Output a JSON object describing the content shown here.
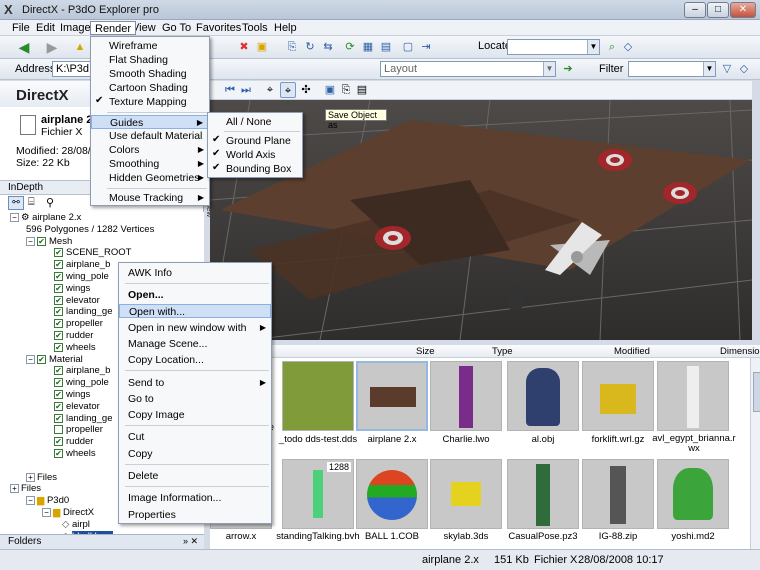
{
  "window": {
    "title": "DirectX - P3dO Explorer pro"
  },
  "menubar": [
    "File",
    "Edit",
    "Image",
    "Render",
    "View",
    "Go To",
    "Favorites",
    "Tools",
    "Help"
  ],
  "toolbar": {
    "locate_label": "Locate",
    "layout_placeholder": "Layout",
    "filter_label": "Filter",
    "address_label": "Address",
    "address_value": "K:\\P3d"
  },
  "left": {
    "header": "DirectX",
    "file_name": "airplane 2.",
    "file_type": "Fichier X",
    "modified": "Modified: 28/08/2",
    "size": "Size: 22 Kb",
    "indepth": "InDepth",
    "folders": "Folders"
  },
  "tree": [
    {
      "label": "airplane 2.x",
      "indent": 10,
      "kind": "root"
    },
    {
      "label": "596 Polygones / 1282 Vertices",
      "indent": 26,
      "kind": "text"
    },
    {
      "label": "Mesh",
      "indent": 26,
      "kind": "check-exp"
    },
    {
      "label": "SCENE_ROOT",
      "indent": 54,
      "kind": "check"
    },
    {
      "label": "airplane_b",
      "indent": 54,
      "kind": "check"
    },
    {
      "label": "wing_pole",
      "indent": 54,
      "kind": "check"
    },
    {
      "label": "wings",
      "indent": 54,
      "kind": "check"
    },
    {
      "label": "elevator",
      "indent": 54,
      "kind": "check"
    },
    {
      "label": "landing_ge",
      "indent": 54,
      "kind": "check"
    },
    {
      "label": "propeller",
      "indent": 54,
      "kind": "check"
    },
    {
      "label": "rudder",
      "indent": 54,
      "kind": "check"
    },
    {
      "label": "wheels",
      "indent": 54,
      "kind": "check"
    },
    {
      "label": "Material",
      "indent": 26,
      "kind": "check-exp"
    },
    {
      "label": "airplane_b",
      "indent": 54,
      "kind": "check"
    },
    {
      "label": "wing_pole",
      "indent": 54,
      "kind": "check"
    },
    {
      "label": "wings",
      "indent": 54,
      "kind": "check"
    },
    {
      "label": "elevator",
      "indent": 54,
      "kind": "check"
    },
    {
      "label": "landing_ge",
      "indent": 54,
      "kind": "check"
    },
    {
      "label": "propeller",
      "indent": 54,
      "kind": "uncheck"
    },
    {
      "label": "rudder",
      "indent": 54,
      "kind": "check"
    },
    {
      "label": "wheels",
      "indent": 54,
      "kind": "check"
    },
    {
      "label": "",
      "indent": 26,
      "kind": "text"
    },
    {
      "label": "Files",
      "indent": 26,
      "kind": "exp"
    },
    {
      "label": "Files",
      "indent": 10,
      "kind": "exp"
    },
    {
      "label": "P3d0",
      "indent": 26,
      "kind": "folder"
    },
    {
      "label": "DirectX",
      "indent": 42,
      "kind": "folder"
    },
    {
      "label": "airpl",
      "indent": 62,
      "kind": "file"
    },
    {
      "label": "bhull.bmp",
      "indent": 62,
      "kind": "file-sel"
    }
  ],
  "render_menu": [
    "Wireframe",
    "Flat Shading",
    "Smooth Shading",
    "Cartoon Shading",
    "Texture Mapping",
    "Guides",
    "Use default Material",
    "Colors",
    "Smoothing",
    "Hidden Geometries",
    "Mouse Tracking"
  ],
  "guides_menu": [
    "All / None",
    "Ground Plane",
    "World Axis",
    "Bounding Box"
  ],
  "tooltip": "Save Object as",
  "viewport_tab": "View",
  "context_menu": [
    "AWK Info",
    "Open...",
    "Open with...",
    "Open in new window with",
    "Manage Scene...",
    "Copy Location...",
    "Send to",
    "Go to",
    "Copy Image",
    "Cut",
    "Copy",
    "Delete",
    "Image Information...",
    "Properties"
  ],
  "columns": [
    "Size",
    "Type",
    "Modified",
    "Dimensions"
  ],
  "thumbs_row1": [
    "_todo dds-test.dds",
    "airplane 2.x",
    "Charlie.lwo",
    "al.obj",
    "forklift.wrl.gz",
    "avl_egypt_brianna.r wx"
  ],
  "thumbs_row1_partial": "te",
  "thumbs_row2": [
    "arrow.x",
    "standingTalking.bvh",
    "BALL 1.COB",
    "skylab.3ds",
    "CasualPose.pz3",
    "IG-88.zip",
    "yoshi.md2"
  ],
  "thumb_badge": "1288",
  "status": {
    "name": "airplane 2.x",
    "size": "151 Kb",
    "type": "Fichier X",
    "date": "28/08/2008 10:17"
  },
  "colors": {
    "viewport": "#3e3c3b",
    "highlight": "#cfe0f6",
    "accent": "#1d4fa0"
  }
}
